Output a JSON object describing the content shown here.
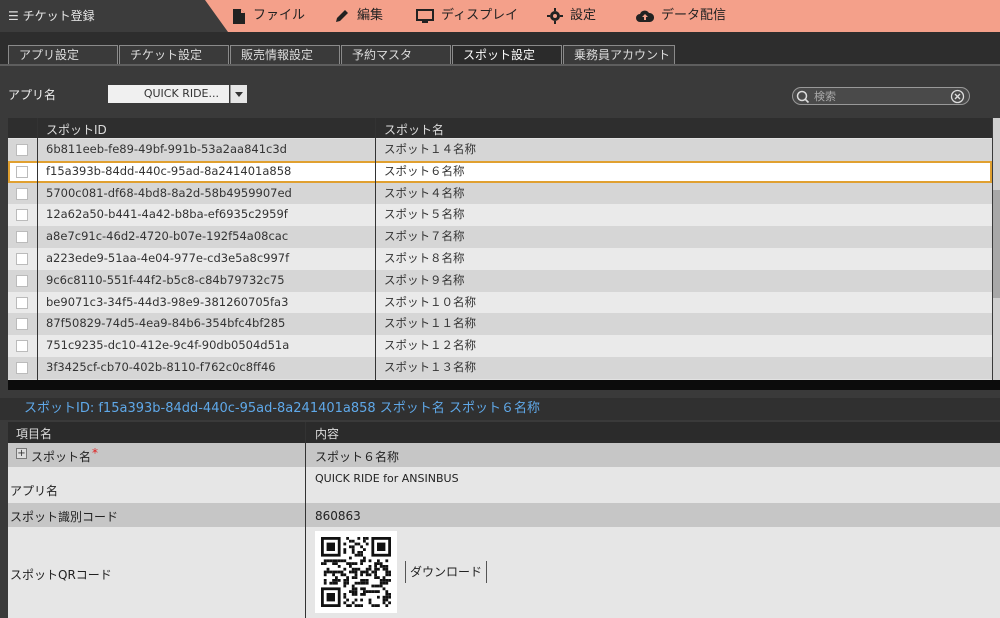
{
  "app": {
    "title": "チケット登録"
  },
  "menu": [
    {
      "label": "ファイル",
      "icon": "document-icon"
    },
    {
      "label": "編集",
      "icon": "pencil-icon"
    },
    {
      "label": "ディスプレイ",
      "icon": "monitor-icon"
    },
    {
      "label": "設定",
      "icon": "gear-icon"
    },
    {
      "label": "データ配信",
      "icon": "cloud-icon"
    }
  ],
  "tabs": [
    "アプリ設定",
    "チケット設定",
    "販売情報設定",
    "予約マスタ",
    "スポット設定",
    "乗務員アカウント"
  ],
  "active_tab": "スポット設定",
  "filter": {
    "label": "アプリ名",
    "selected": "QUICK RIDE...",
    "search_placeholder": "検索"
  },
  "grid": {
    "columns": [
      "スポットID",
      "スポット名"
    ],
    "rows": [
      {
        "id": "6b811eeb-fe89-49bf-991b-53a2aa841c3d",
        "name": "スポット１４名称"
      },
      {
        "id": "f15a393b-84dd-440c-95ad-8a241401a858",
        "name": "スポット６名称"
      },
      {
        "id": "5700c081-df68-4bd8-8a2d-58b4959907ed",
        "name": "スポット４名称"
      },
      {
        "id": "12a62a50-b441-4a42-b8ba-ef6935c2959f",
        "name": "スポット５名称"
      },
      {
        "id": "a8e7c91c-46d2-4720-b07e-192f54a08cac",
        "name": "スポット７名称"
      },
      {
        "id": "a223ede9-51aa-4e04-977e-cd3e5a8c997f",
        "name": "スポット８名称"
      },
      {
        "id": "9c6c8110-551f-44f2-b5c8-c84b79732c75",
        "name": "スポット９名称"
      },
      {
        "id": "be9071c3-34f5-44d3-98e9-381260705fa3",
        "name": "スポット１０名称"
      },
      {
        "id": "87f50829-74d5-4ea9-84b6-354bfc4bf285",
        "name": "スポット１１名称"
      },
      {
        "id": "751c9235-dc10-412e-9c4f-90db0504d51a",
        "name": "スポット１２名称"
      },
      {
        "id": "3f3425cf-cb70-402b-8110-f762c0c8ff46",
        "name": "スポット１３名称"
      }
    ]
  },
  "detail": {
    "header": "スポットID:  f15a393b-84dd-440c-95ad-8a241401a858   スポット名   スポット６名称",
    "columns": [
      "項目名",
      "内容"
    ],
    "fields": [
      {
        "label": "スポット名",
        "value": "スポット６名称",
        "required_mark": "*",
        "expand": "+"
      },
      {
        "label": "アプリ名",
        "value": "QUICK RIDE for ANSINBUS"
      },
      {
        "label": "スポット識別コード",
        "value": "860863"
      },
      {
        "label": "スポットQRコード",
        "value": ""
      }
    ],
    "download_label": "ダウンロード"
  },
  "colors": {
    "accent": "#f4a08a",
    "selection": "#e0a030",
    "link": "#5fa8e8"
  }
}
